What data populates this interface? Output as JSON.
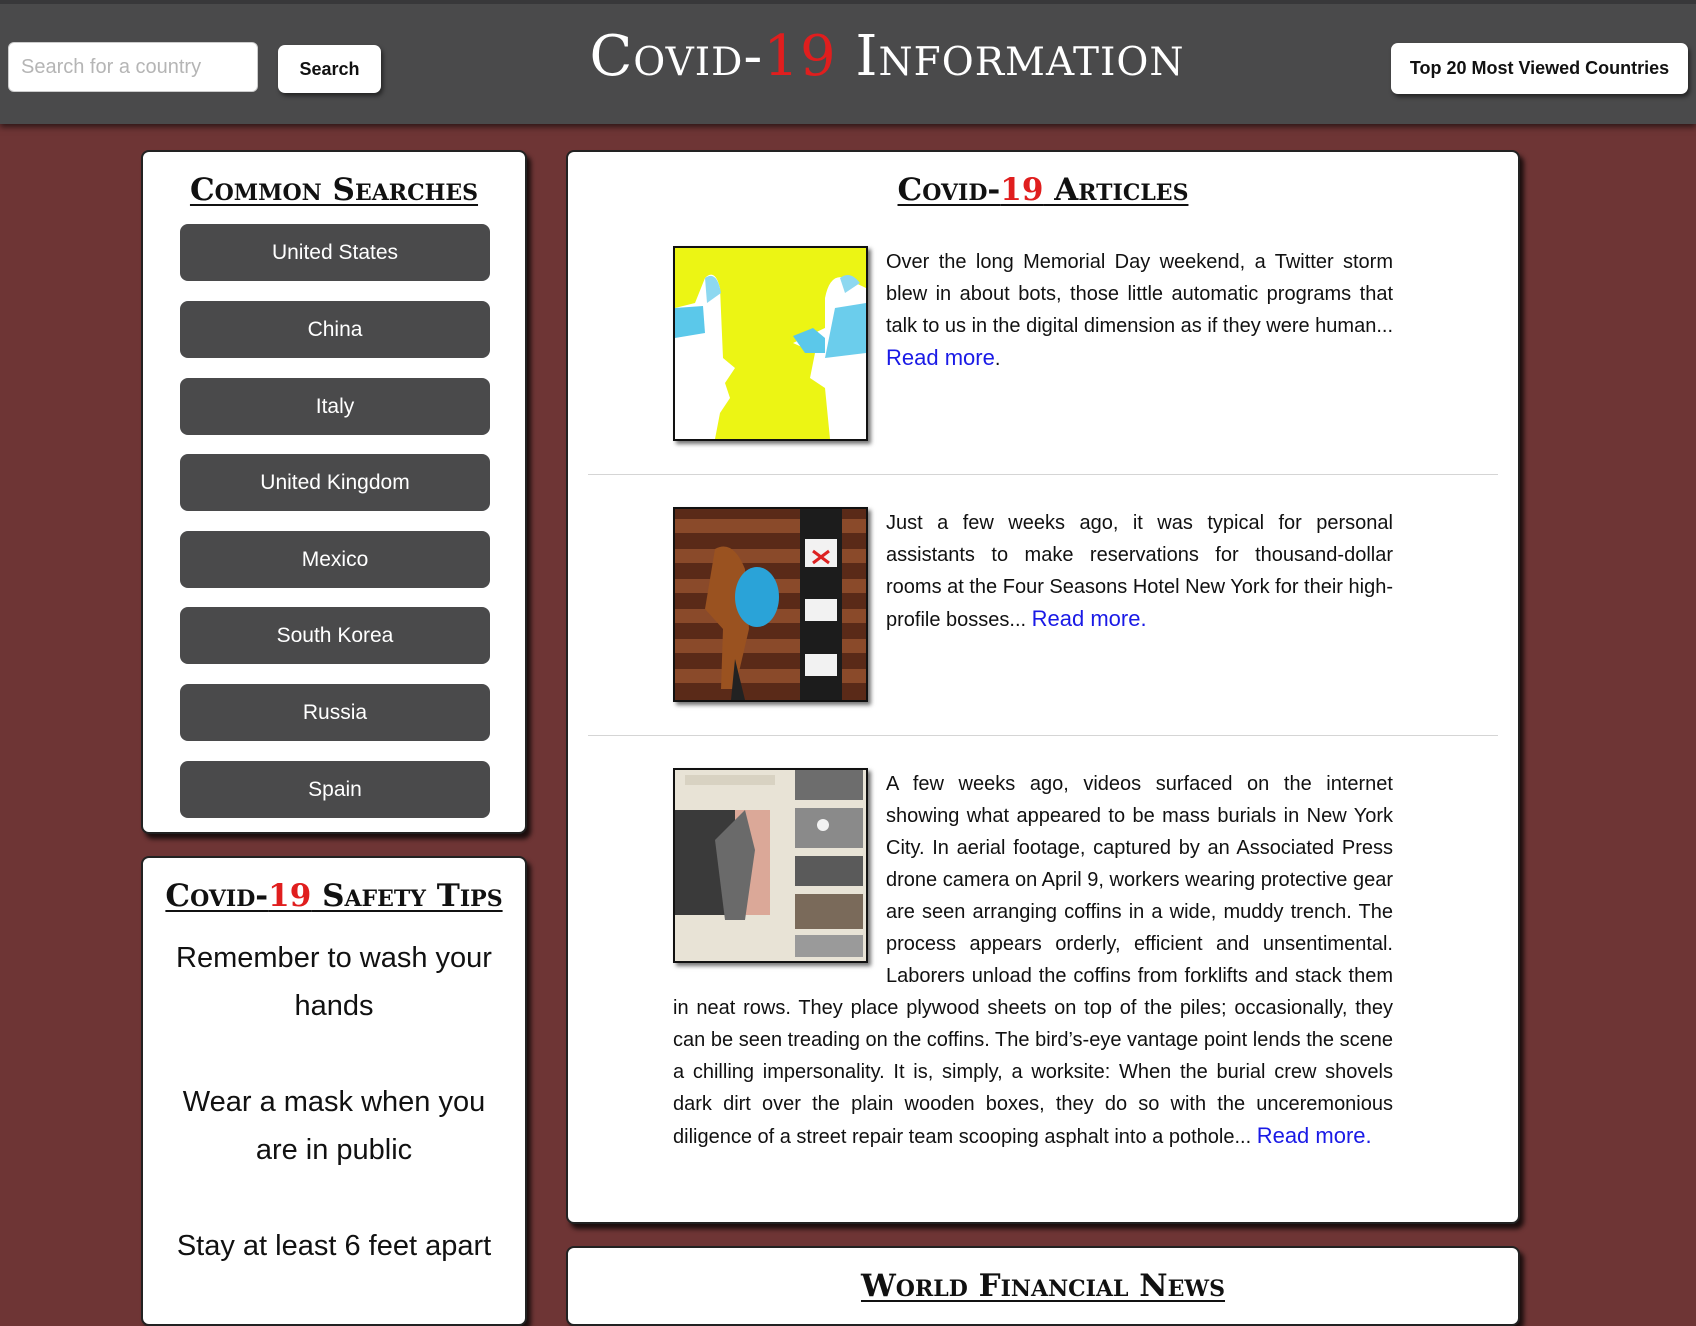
{
  "header": {
    "title_pre": "Covid-",
    "title_num": "19",
    "title_post": " Information",
    "search_placeholder": "Search for a country",
    "search_button": "Search",
    "top20_button": "Top 20 Most Viewed Countries"
  },
  "common_searches": {
    "heading": "Common Searches",
    "countries": [
      "United States",
      "China",
      "Italy",
      "United Kingdom",
      "Mexico",
      "South Korea",
      "Russia",
      "Spain"
    ]
  },
  "safety": {
    "heading_pre": "Covid-",
    "heading_num": "19",
    "heading_post": " Safety Tips",
    "tips": [
      "Remember to wash your hands",
      "Wear a mask when you are in public",
      "Stay at least 6 feet apart"
    ]
  },
  "articles": {
    "heading_pre": "Covid-",
    "heading_num": "19",
    "heading_post": " Articles",
    "items": [
      {
        "text": "Over the long Memorial Day weekend, a Twitter storm blew in about bots, those little automatic programs that talk to us in the digital dimension as if they were human... ",
        "read_more": "Read more",
        "suffix": "."
      },
      {
        "text": "Just a few weeks ago, it was typical for personal assistants to make reservations for thousand-dollar rooms at the Four Seasons Hotel New York for their high-profile bosses... ",
        "read_more": "Read more.",
        "suffix": ""
      },
      {
        "text": "A few weeks ago, videos surfaced on the internet showing what appeared to be mass burials in New York City. In aerial footage, captured by an Associated Press drone camera on April 9, workers wearing protective gear are seen arranging coffins in a wide, muddy trench. The process appears orderly, efficient and unsentimental. Laborers unload the coffins from forklifts and stack them in neat rows. They place plywood sheets on top of the piles; occasionally, they can be seen treading on the coffins. The bird’s-eye vantage point lends the scene a chilling impersonality. It is, simply, a worksite: When the burial crew shovels dark dirt over the plain wooden boxes, they do so with the unceremonious diligence of a street repair team scooping asphalt into a pothole... ",
        "read_more": "Read more.",
        "suffix": ""
      }
    ]
  },
  "financial": {
    "heading": "World Financial News"
  },
  "colors": {
    "background": "#6e3535",
    "topbar": "#4a4a4b",
    "accent_red": "#e01e1e",
    "link_blue": "#1a1ae6",
    "country_button": "#4a4a4b"
  }
}
